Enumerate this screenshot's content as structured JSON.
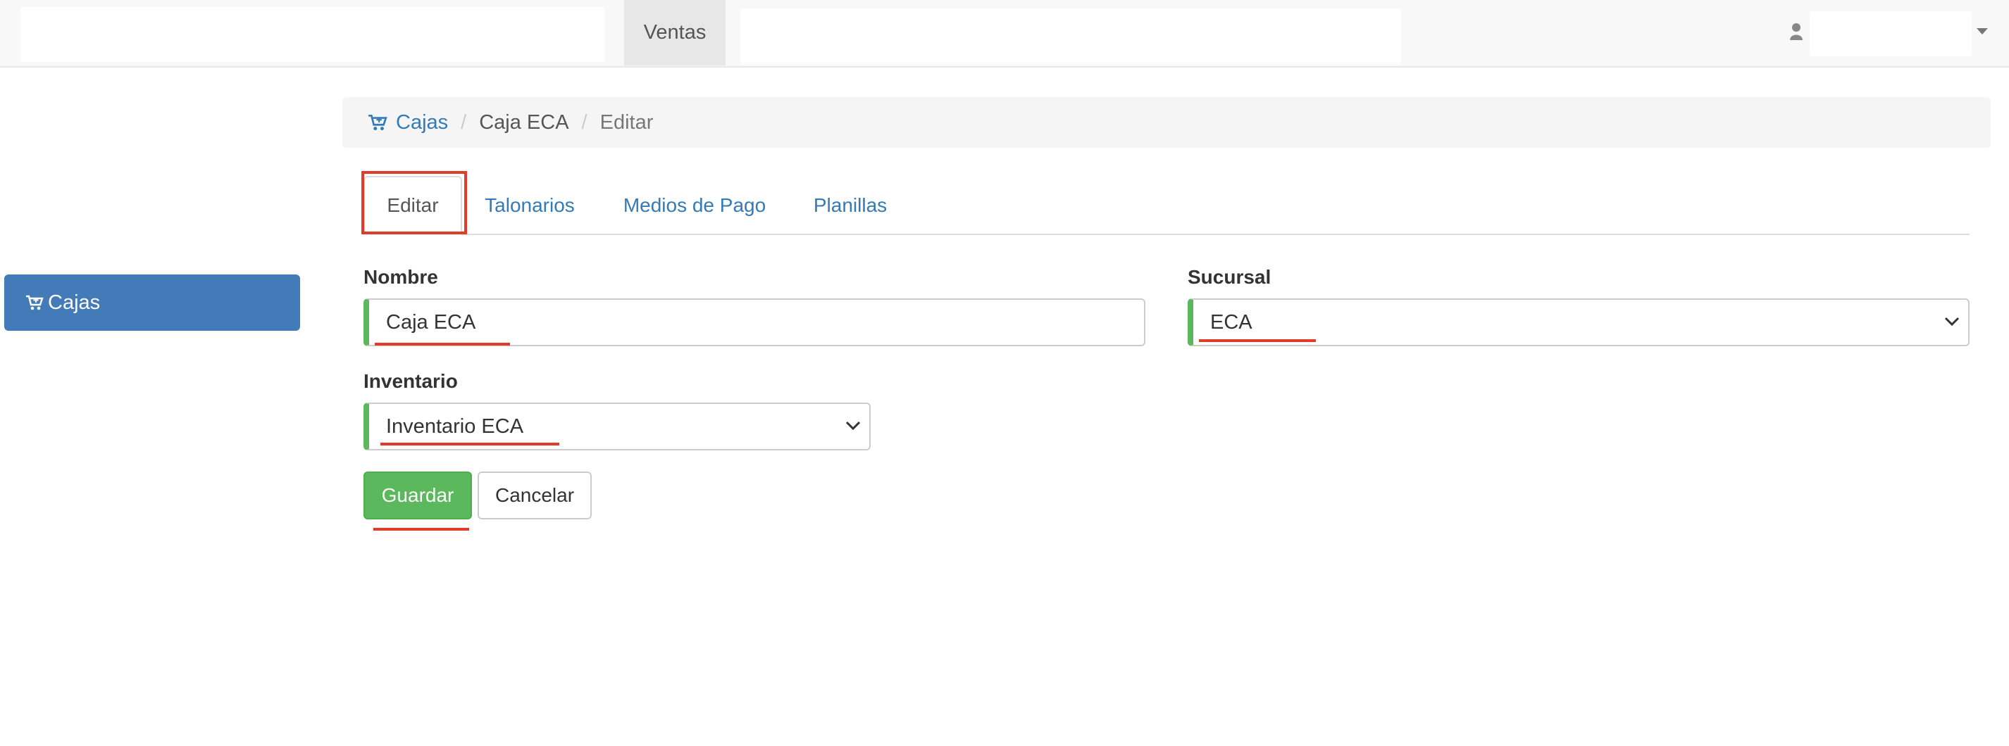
{
  "navbar": {
    "active_tab": "Ventas"
  },
  "sidebar": {
    "items": [
      {
        "label": "Cajas",
        "icon": "cart-icon"
      }
    ]
  },
  "breadcrumb": {
    "items": [
      "Cajas",
      "Caja ECA",
      "Editar"
    ],
    "separator": "/"
  },
  "tabs": [
    {
      "label": "Editar"
    },
    {
      "label": "Talonarios"
    },
    {
      "label": "Medios de Pago"
    },
    {
      "label": "Planillas"
    }
  ],
  "form": {
    "nombre": {
      "label": "Nombre",
      "value": "Caja ECA"
    },
    "sucursal": {
      "label": "Sucursal",
      "value": "ECA"
    },
    "inventario": {
      "label": "Inventario",
      "value": "Inventario ECA"
    }
  },
  "buttons": {
    "save": "Guardar",
    "cancel": "Cancelar"
  },
  "colors": {
    "primary": "#337ab7",
    "sidebar_active": "#437ab8",
    "success": "#5cb85c",
    "annotation": "#e23b2a"
  }
}
